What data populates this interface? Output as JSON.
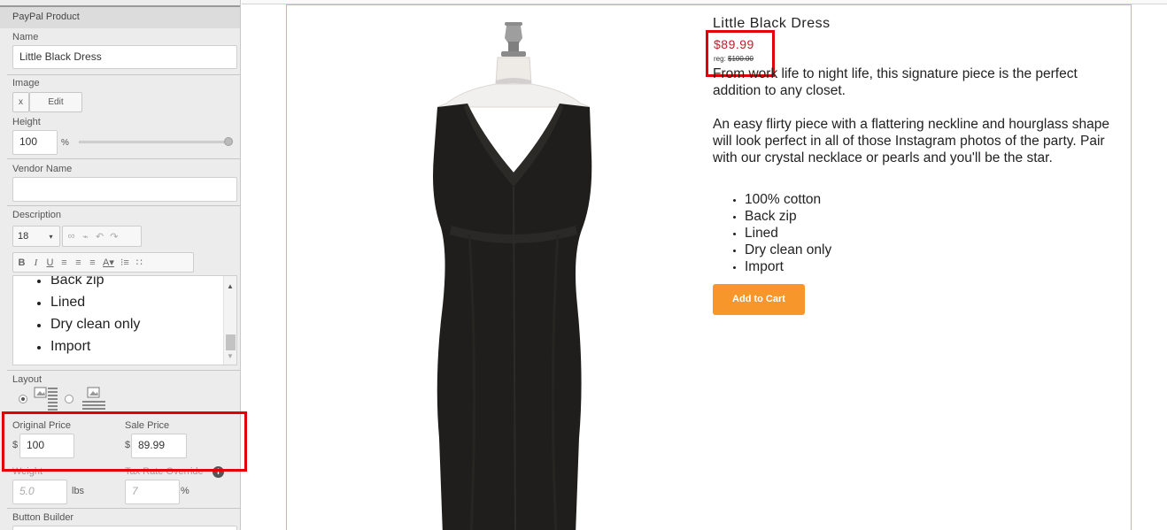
{
  "panel": {
    "title": "PayPal Product",
    "name": {
      "label": "Name",
      "value": "Little Black Dress"
    },
    "image": {
      "label": "Image",
      "remove_label": "x",
      "edit_label": "Edit"
    },
    "height": {
      "label": "Height",
      "value": "100",
      "unit": "%",
      "slider_percent": 100
    },
    "vendor": {
      "label": "Vendor Name",
      "value": ""
    },
    "description": {
      "label": "Description",
      "font_size": "18",
      "editor_items": [
        "Back zip",
        "Lined",
        "Dry clean only",
        "Import"
      ]
    },
    "layout": {
      "label": "Layout",
      "selected": "image-left"
    },
    "original_price": {
      "label": "Original Price",
      "currency": "$",
      "value": "100"
    },
    "sale_price": {
      "label": "Sale Price",
      "currency": "$",
      "value": "89.99"
    },
    "weight": {
      "label": "Weight",
      "placeholder": "5.0",
      "unit": "lbs"
    },
    "tax": {
      "label": "Tax Rate Override",
      "placeholder": "7",
      "unit": "%",
      "info": "i"
    },
    "button_builder": {
      "label": "Button Builder"
    }
  },
  "product": {
    "title": "Little Black Dress",
    "sale_price": "$89.99",
    "reg_label": "reg:",
    "reg_price": "$100.00",
    "description": [
      "From work life to night life, this signature piece is the perfect addition to any closet.",
      "An easy flirty piece with a flattering neckline and hourglass shape will look perfect in all of those Instagram photos of the party.  Pair with our crystal necklace or pearls and you'll be the star."
    ],
    "bullets": [
      "100% cotton",
      "Back zip",
      "Lined",
      "Dry clean only",
      "Import"
    ],
    "cart_label": "Add to Cart"
  },
  "colors": {
    "highlight": "#e0000a",
    "sale_price": "#c0202a",
    "cart_button": "#f7962b",
    "frame_border": "#e8b84a"
  }
}
